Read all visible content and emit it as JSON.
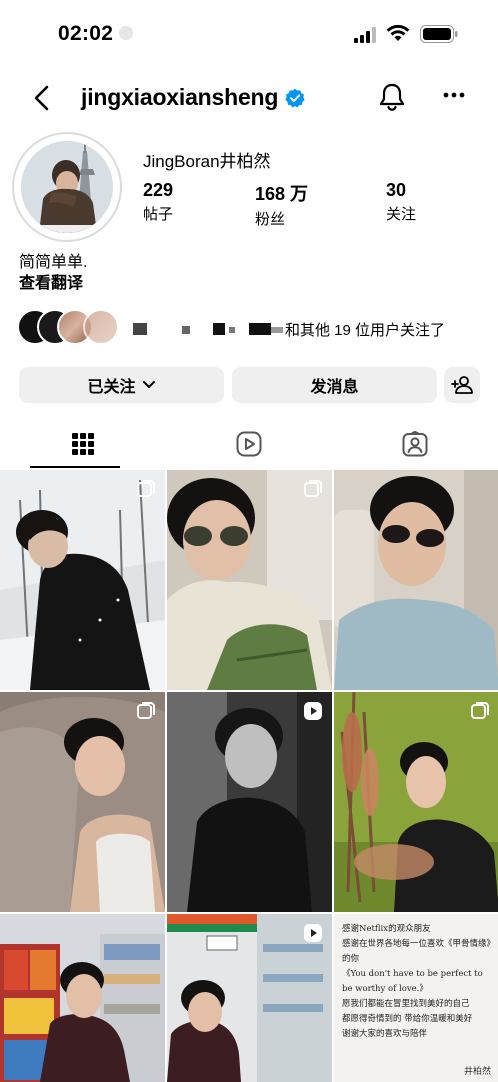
{
  "status_bar": {
    "time": "02:02"
  },
  "header": {
    "username": "jingxiaoxiansheng"
  },
  "profile": {
    "full_name": "JingBoran井柏然",
    "stats": [
      {
        "value": "229",
        "label": "帖子"
      },
      {
        "value": "168 万",
        "label": "粉丝"
      },
      {
        "value": "30",
        "label": "关注"
      }
    ],
    "bio": "简简单单.",
    "translate": "查看翻译",
    "followed_by": "和其他 19 位用户关注了"
  },
  "actions": {
    "following": "已关注",
    "message": "发消息"
  },
  "tabs": [
    {
      "icon": "grid-icon",
      "active": true
    },
    {
      "icon": "reels-icon",
      "active": false
    },
    {
      "icon": "tagged-icon",
      "active": false
    }
  ],
  "posts": [
    {
      "badge": "carousel-icon",
      "scene": "snowy forest portrait in black coat"
    },
    {
      "badge": "carousel-icon",
      "scene": "car selfie with aviator sunglasses and green bag"
    },
    {
      "badge": "none",
      "scene": "car selfie with dark sunglasses and blue shirt"
    },
    {
      "badge": "carousel-icon",
      "scene": "lying on pillow in white tank top"
    },
    {
      "badge": "reel-icon",
      "scene": "black and white portrait"
    },
    {
      "badge": "carousel-icon",
      "scene": "green wall with pampas grass"
    },
    {
      "badge": "none",
      "scene": "convenience store snack aisle"
    },
    {
      "badge": "reel-icon",
      "scene": "7-Eleven store entrance"
    },
    {
      "badge": "none",
      "scene": "handwritten letter"
    }
  ],
  "letter": {
    "lines": [
      "感谢Netflix的观众朋友",
      "感谢在世界各地每一位喜欢《甲骨情缘》的你",
      "《You don't have to be perfect to be worthy of love.》",
      "愿我们都能在冒里找到美好的自己",
      "都愿得奇情到的 带给你温暖和美好",
      "谢谢大家的喜欢与陪伴"
    ],
    "signature": "井柏然"
  },
  "colors": {
    "verified": "#0095f6",
    "button_bg": "#efefef",
    "divider": "#dbdbdb"
  }
}
